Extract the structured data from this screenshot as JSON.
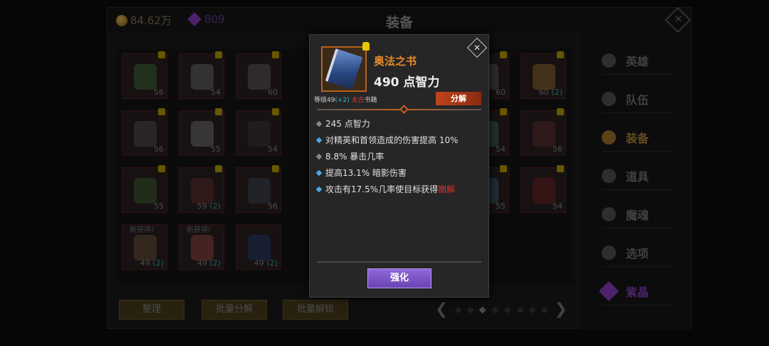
{
  "header": {
    "gold": "84.62万",
    "gems": "809",
    "title": "装备"
  },
  "grid": {
    "slots": [
      {
        "level": "56",
        "plus": "",
        "color": "#4a8a4a",
        "locked": true
      },
      {
        "level": "54",
        "plus": "",
        "color": "#888888",
        "locked": true
      },
      {
        "level": "60",
        "plus": "",
        "color": "#777777",
        "locked": true
      },
      {
        "level": "60",
        "plus": "",
        "color": "#777777",
        "locked": true
      },
      {
        "level": "60",
        "plus": "(2)",
        "color": "#c08a3a",
        "locked": true
      },
      {
        "level": "56",
        "plus": "",
        "color": "#666666",
        "locked": true
      },
      {
        "level": "55",
        "plus": "",
        "color": "#999999",
        "locked": true
      },
      {
        "level": "54",
        "plus": "",
        "color": "#444444",
        "locked": true
      },
      {
        "level": "54",
        "plus": "",
        "color": "#4a8a7a",
        "locked": true
      },
      {
        "level": "56",
        "plus": "",
        "color": "#7a3a3a",
        "locked": true
      },
      {
        "level": "55",
        "plus": "",
        "color": "#4a7a3a",
        "locked": true
      },
      {
        "level": "59",
        "plus": "(2)",
        "color": "#7a3a3a",
        "locked": true
      },
      {
        "level": "56",
        "plus": "",
        "color": "#4a5a6a",
        "locked": true
      },
      {
        "level": "55",
        "plus": "",
        "color": "#4a7a9a",
        "locked": true
      },
      {
        "level": "54",
        "plus": "",
        "color": "#8a2a2a",
        "locked": true
      },
      {
        "level": "49",
        "plus": "(2)",
        "color": "#8a6a4a",
        "new": "新获得!"
      },
      {
        "level": "49",
        "plus": "(2)",
        "color": "#c06050",
        "new": "新获得!"
      },
      {
        "level": "49",
        "plus": "(2)",
        "color": "#2a4a8a"
      }
    ]
  },
  "buttons": {
    "sort": "整理",
    "batch_dismantle": "批量分解",
    "batch_unlock": "批量解锁"
  },
  "pager": {
    "prev": "❮",
    "next": "❯",
    "pages": 8,
    "current": 3
  },
  "sidebar": {
    "items": [
      {
        "label": "英雄"
      },
      {
        "label": "队伍"
      },
      {
        "label": "装备"
      },
      {
        "label": "道具"
      },
      {
        "label": "魔魂"
      },
      {
        "label": "选项"
      },
      {
        "label": "紫晶"
      }
    ]
  },
  "popup": {
    "name": "奥法之书",
    "main_stat": "490 点智力",
    "level_label": "等级49",
    "level_bonus": "(+2)",
    "rarity_tag": "太古",
    "category": "书籍",
    "dismantle_label": "分解",
    "stats": [
      {
        "text": "245 点智力",
        "bullet": "gray"
      },
      {
        "text": "对精英和首领造成的伤害提高 10%",
        "bullet": "blue"
      },
      {
        "text": "8.8% 暴击几率",
        "bullet": "gray"
      },
      {
        "text": "提高13.1% 暗影伤害",
        "bullet": "blue"
      },
      {
        "text": "攻击有17.5%几率使目标获得",
        "suffix": "崩解",
        "bullet": "blue"
      }
    ],
    "enhance_label": "强化"
  }
}
